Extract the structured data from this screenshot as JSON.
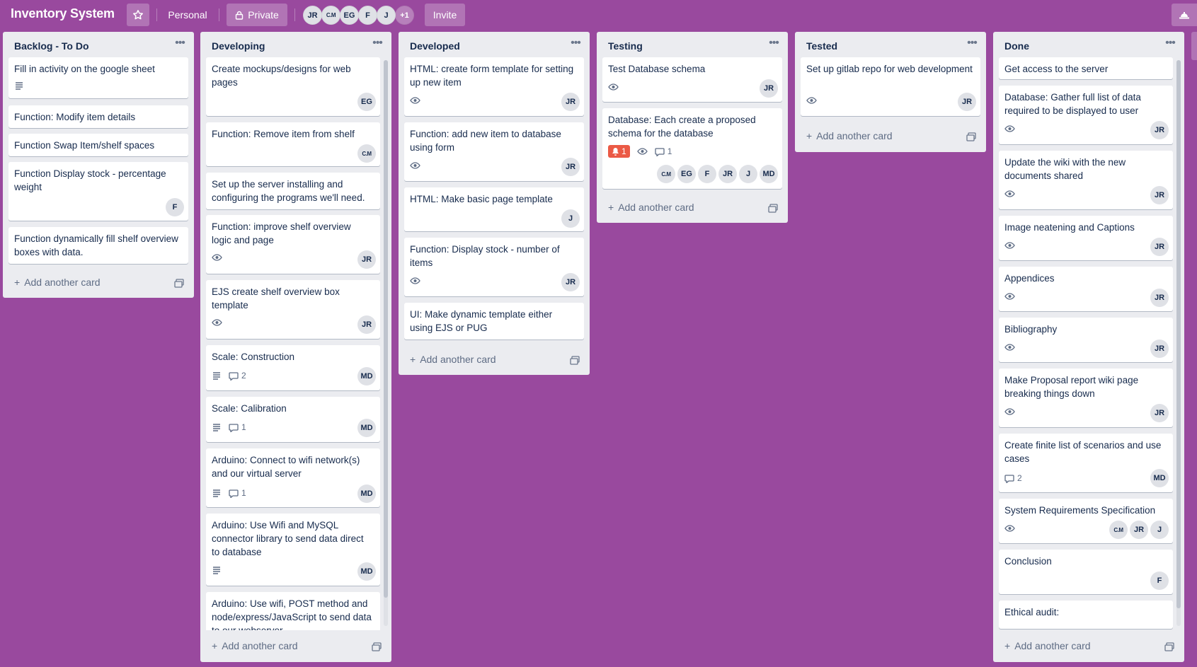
{
  "board": {
    "title": "Inventory System",
    "visibility_team": "Personal",
    "visibility": "Private",
    "invite_label": "Invite",
    "members": [
      "JR",
      "C.M",
      "EG",
      "F",
      "J"
    ],
    "members_more": "+1",
    "background_color": "#99499e"
  },
  "lists": [
    {
      "title": "Backlog - To Do",
      "add_label": "Add another card",
      "cards": [
        {
          "title": "Fill in activity on the google sheet",
          "description": true
        },
        {
          "title": "Function: Modify item details"
        },
        {
          "title": "Function Swap Item/shelf spaces"
        },
        {
          "title": "Function Display stock - percentage weight",
          "members": [
            "F"
          ]
        },
        {
          "title": "Function dynamically fill shelf overview boxes with data."
        }
      ]
    },
    {
      "title": "Developing",
      "add_label": "Add another card",
      "cards": [
        {
          "title": "Create mockups/designs for web pages",
          "members": [
            "EG"
          ]
        },
        {
          "title": "Function: Remove item from shelf",
          "members": [
            "C.M"
          ]
        },
        {
          "title": "Set up the server installing and configuring the programs we'll need."
        },
        {
          "title": "Function: improve shelf overview logic and page",
          "watch": true,
          "members": [
            "JR"
          ]
        },
        {
          "title": "EJS create shelf overview box template",
          "watch": true,
          "members": [
            "JR"
          ]
        },
        {
          "title": "Scale: Construction",
          "description": true,
          "comments": "2",
          "members": [
            "MD"
          ]
        },
        {
          "title": "Scale: Calibration",
          "description": true,
          "comments": "1",
          "members": [
            "MD"
          ]
        },
        {
          "title": "Arduino: Connect to wifi network(s) and our virtual server",
          "description": true,
          "comments": "1",
          "members": [
            "MD"
          ]
        },
        {
          "title": "Arduino: Use Wifi and MySQL connector library to send data direct to database",
          "description": true,
          "members": [
            "MD"
          ]
        },
        {
          "title": "Arduino: Use wifi, POST method and node/express/JavaScript to send data to our webserver"
        }
      ]
    },
    {
      "title": "Developed",
      "add_label": "Add another card",
      "cards": [
        {
          "title": "HTML: create form template for setting up new item",
          "watch": true,
          "members": [
            "JR"
          ]
        },
        {
          "title": "Function: add new item to database using form",
          "watch": true,
          "members": [
            "JR"
          ]
        },
        {
          "title": "HTML: Make basic page template",
          "members": [
            "J"
          ]
        },
        {
          "title": "Function: Display stock - number of items",
          "watch": true,
          "members": [
            "JR"
          ]
        },
        {
          "title": "UI: Make dynamic template either using EJS or PUG"
        }
      ]
    },
    {
      "title": "Testing",
      "add_label": "Add another card",
      "cards": [
        {
          "title": "Test Database schema",
          "watch": true,
          "members": [
            "JR"
          ]
        },
        {
          "title": "Database: Each create a proposed schema for the database",
          "alarm": "1",
          "watch": true,
          "comments": "1",
          "members": [
            "C.M",
            "EG",
            "F",
            "JR",
            "J",
            "MD"
          ]
        }
      ]
    },
    {
      "title": "Tested",
      "add_label": "Add another card",
      "cards": [
        {
          "title": "Set up gitlab repo for web development",
          "watch": true,
          "members": [
            "JR"
          ]
        }
      ]
    },
    {
      "title": "Done",
      "add_label": "Add another card",
      "cards": [
        {
          "title": "Get access to the server"
        },
        {
          "title": "Database: Gather full list of data required to be displayed to user",
          "watch": true,
          "members": [
            "JR"
          ]
        },
        {
          "title": "Update the wiki with the new documents shared",
          "watch": true,
          "members": [
            "JR"
          ]
        },
        {
          "title": "Image neatening and Captions",
          "watch": true,
          "members": [
            "JR"
          ]
        },
        {
          "title": "Appendices",
          "watch": true,
          "members": [
            "JR"
          ]
        },
        {
          "title": "Bibliography",
          "watch": true,
          "members": [
            "JR"
          ]
        },
        {
          "title": "Make Proposal report wiki page breaking things down",
          "watch": true,
          "members": [
            "JR"
          ]
        },
        {
          "title": "Create finite list of scenarios and use cases",
          "comments": "2",
          "members": [
            "MD"
          ]
        },
        {
          "title": "System Requirements Specification",
          "watch": true,
          "members": [
            "C.M",
            "JR",
            "J"
          ]
        },
        {
          "title": "Conclusion",
          "members": [
            "F"
          ]
        },
        {
          "title": "Ethical audit:"
        }
      ]
    }
  ]
}
